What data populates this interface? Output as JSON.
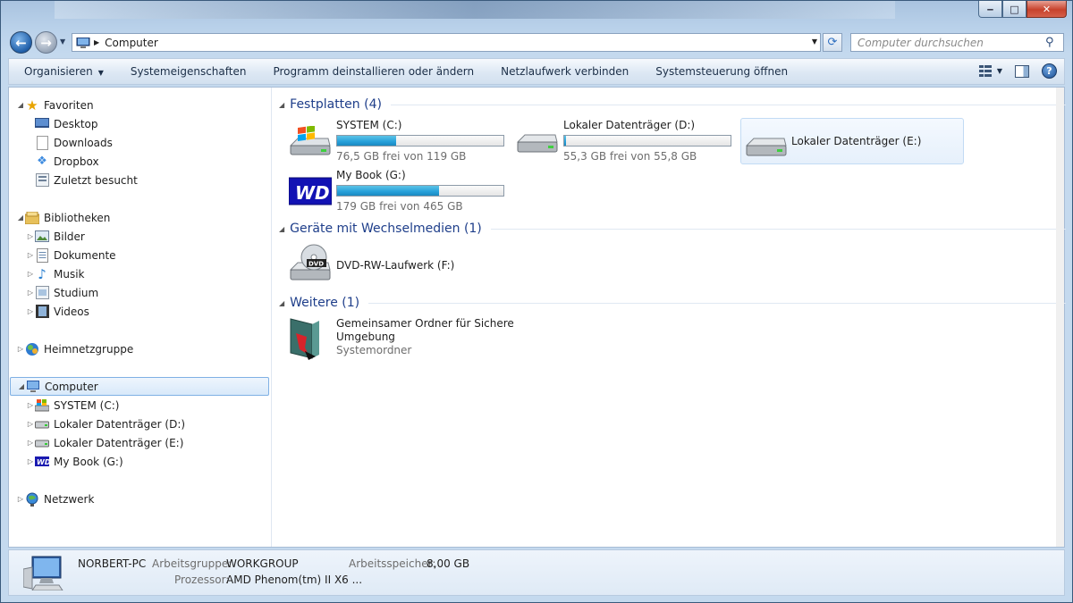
{
  "address": {
    "location": "Computer"
  },
  "search": {
    "placeholder": "Computer durchsuchen"
  },
  "window_buttons": {
    "minimize": "‒",
    "maximize": "□",
    "close": "✕"
  },
  "toolbar": {
    "organize": "Organisieren",
    "system_properties": "Systemeigenschaften",
    "uninstall": "Programm deinstallieren oder ändern",
    "map_drive": "Netzlaufwerk verbinden",
    "control_panel": "Systemsteuerung öffnen",
    "help": "?"
  },
  "nav": {
    "favorites": {
      "label": "Favoriten",
      "items": [
        "Desktop",
        "Downloads",
        "Dropbox",
        "Zuletzt besucht"
      ]
    },
    "libraries": {
      "label": "Bibliotheken",
      "items": [
        "Bilder",
        "Dokumente",
        "Musik",
        "Studium",
        "Videos"
      ]
    },
    "homegroup": "Heimnetzgruppe",
    "computer": {
      "label": "Computer",
      "items": [
        "SYSTEM (C:)",
        "Lokaler Datenträger (D:)",
        "Lokaler Datenträger (E:)",
        "My Book (G:)"
      ]
    },
    "network": "Netzwerk"
  },
  "groups": {
    "hard_disks": {
      "title": "Festplatten (4)",
      "drives": [
        {
          "name": "SYSTEM (C:)",
          "free": "76,5 GB frei von 119 GB",
          "used_fraction": 0.357
        },
        {
          "name": "Lokaler Datenträger (D:)",
          "free": "55,3 GB frei von 55,8 GB",
          "used_fraction": 0.009
        },
        {
          "name": "Lokaler Datenträger (E:)"
        },
        {
          "name": "My Book (G:)",
          "free": "179 GB frei von 465 GB",
          "used_fraction": 0.615
        }
      ]
    },
    "removable": {
      "title": "Geräte mit Wechselmedien (1)",
      "items": [
        {
          "name": "DVD-RW-Laufwerk (F:)"
        }
      ]
    },
    "other": {
      "title": "Weitere (1)",
      "items": [
        {
          "name_line1": "Gemeinsamer Ordner für Sichere",
          "name_line2": "Umgebung",
          "type": "Systemordner"
        }
      ]
    }
  },
  "details": {
    "computer_name": "NORBERT-PC",
    "workgroup_label": "Arbeitsgruppe:",
    "workgroup": "WORKGROUP",
    "memory_label": "Arbeitsspeicher:",
    "memory": "8,00 GB",
    "cpu_label": "Prozessor:",
    "cpu": "AMD Phenom(tm) II X6 ..."
  },
  "colors": {
    "accent_blue": "#1e3e8a",
    "bar_fill": "#26a0da",
    "selection": "#d8e9fa"
  }
}
